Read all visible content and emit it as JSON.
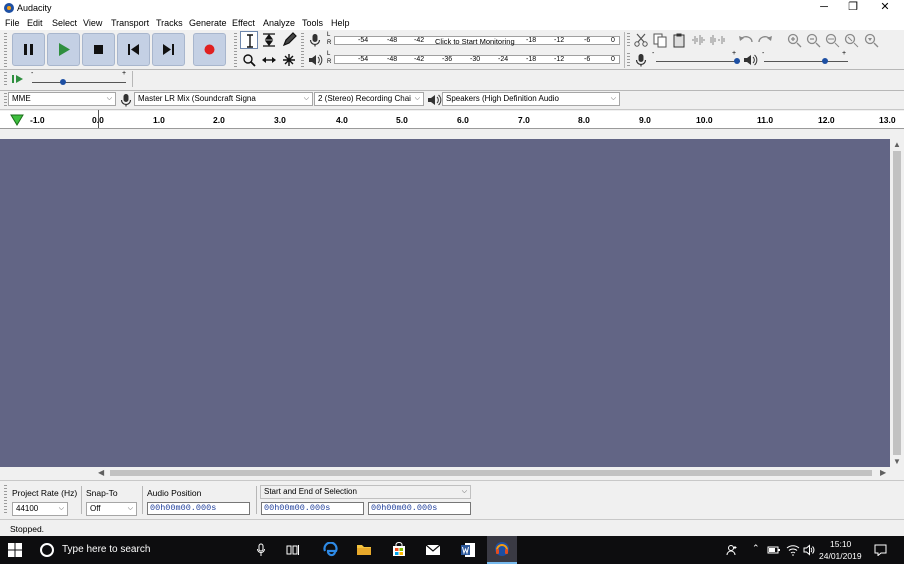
{
  "window": {
    "title": "Audacity",
    "minimize": "─",
    "restore": "❐",
    "close": "✕"
  },
  "menu": [
    "File",
    "Edit",
    "Select",
    "View",
    "Transport",
    "Tracks",
    "Generate",
    "Effect",
    "Analyze",
    "Tools",
    "Help"
  ],
  "meters": {
    "record_ticks": [
      "-54",
      "-48",
      "-42",
      "-18",
      "-12",
      "-6",
      "0"
    ],
    "record_msg": "Click to Start Monitoring",
    "play_ticks": [
      "-54",
      "-48",
      "-42",
      "-36",
      "-30",
      "-24",
      "-18",
      "-12",
      "-6",
      "0"
    ],
    "left_channel": "L",
    "right_channel": "R"
  },
  "sliders": {
    "play_speed_min": "-",
    "play_speed_max": "+",
    "mic_min": "-",
    "mic_max": "+",
    "speaker_min": "-",
    "speaker_max": "+"
  },
  "devices": {
    "host": "MME",
    "recording_device": "Master LR Mix (Soundcraft Signa",
    "channels": "2 (Stereo) Recording Chai",
    "playback_device": "Speakers (High Definition Audio"
  },
  "ruler": {
    "labels": [
      "-1.0",
      "0.0",
      "1.0",
      "2.0",
      "3.0",
      "4.0",
      "5.0",
      "6.0",
      "7.0",
      "8.0",
      "9.0",
      "10.0",
      "11.0",
      "12.0",
      "13.0"
    ]
  },
  "selection_toolbar": {
    "project_rate_label": "Project Rate (Hz)",
    "project_rate": "44100",
    "snap_to_label": "Snap-To",
    "snap_to": "Off",
    "audio_position_label": "Audio Position",
    "audio_position": "00h00m00.000s",
    "selection_mode": "Start and End of Selection",
    "selection_start": "00h00m00.000s",
    "selection_end": "00h00m00.000s"
  },
  "status": "Stopped.",
  "taskbar": {
    "search_placeholder": "Type here to search",
    "time": "15:10",
    "date": "24/01/2019"
  },
  "colors": {
    "track_area": "#626585",
    "button_face": "#c4d0e4",
    "record_red": "#e02020",
    "play_green": "#2f8f3f",
    "accent_blue": "#1d4fa3"
  }
}
